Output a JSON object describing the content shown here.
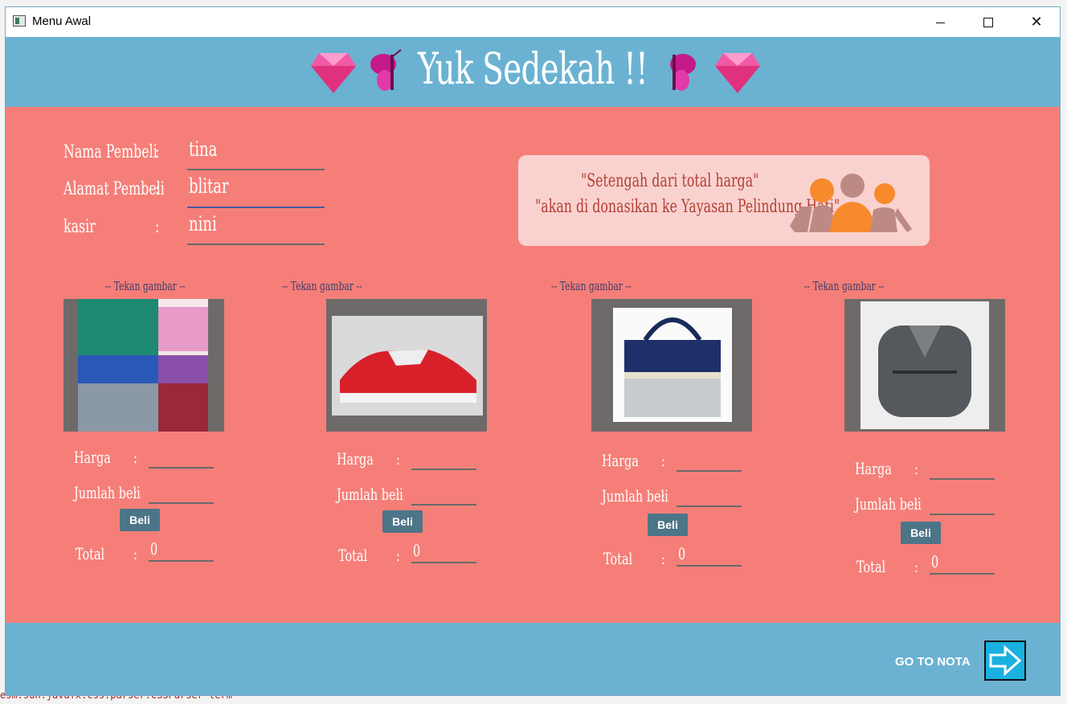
{
  "window": {
    "title": "Menu Awal",
    "background_console_text": "esm.sun.javafx.css.parser.CSSParser term"
  },
  "header": {
    "title": "Yuk Sedekah !!"
  },
  "form": {
    "nama_label": "Nama Pembeli",
    "alamat_label": "Alamat Pembeli",
    "kasir_label": "kasir",
    "colon": ":",
    "nama_value": "tina",
    "alamat_value": "blitar",
    "kasir_value": "nini"
  },
  "note": {
    "line1": "\"Setengah dari total harga\"",
    "line2": "\"akan di donasikan ke Yayasan Pelindung Hati\""
  },
  "products": [
    {
      "caption": "-- Tekan gambar --",
      "image": "masks-image",
      "harga_label": "Harga",
      "jumlah_label": "Jumlah beli",
      "colon": ":",
      "buy_label": "Beli",
      "total_label": "Total",
      "total_value": "0"
    },
    {
      "caption": "-- Tekan gambar --",
      "image": "sneakers-image",
      "harga_label": "Harga",
      "jumlah_label": "Jumlah beli",
      "colon": ":",
      "buy_label": "Beli",
      "total_label": "Total",
      "total_value": "0"
    },
    {
      "caption": "-- Tekan gambar --",
      "image": "tote-bag-image",
      "harga_label": "Harga",
      "jumlah_label": "Jumlah beli",
      "colon": ":",
      "buy_label": "Beli",
      "total_label": "Total",
      "total_value": "0"
    },
    {
      "caption": "-- Tekan gambar --",
      "image": "backpack-image",
      "harga_label": "Harga",
      "jumlah_label": "Jumlah beli",
      "colon": ":",
      "buy_label": "Beli",
      "total_label": "Total",
      "total_value": "0"
    }
  ],
  "footer": {
    "goto_label": "GO TO NOTA",
    "icon": "arrow-right-icon"
  },
  "colors": {
    "header": "#6bb2d2",
    "main": "#f57f78",
    "button": "#4d7588"
  }
}
